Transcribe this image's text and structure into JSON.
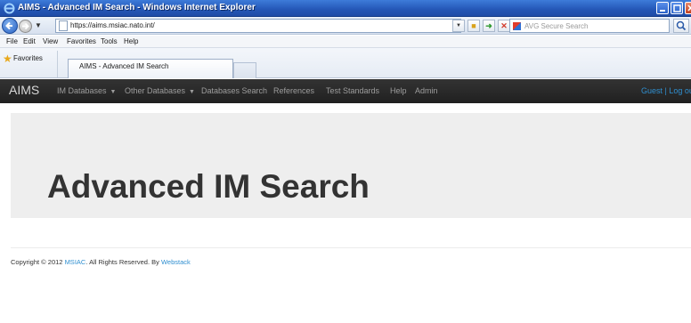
{
  "window": {
    "title": "AIMS - Advanced IM Search - Windows Internet Explorer"
  },
  "browser": {
    "address": "https://aims.msiac.nato.int/",
    "search_placeholder": "AVG Secure Search",
    "menu": [
      "File",
      "Edit",
      "View",
      "Favorites",
      "Tools",
      "Help"
    ],
    "favorites_label": "Favorites",
    "tab_title": "AIMS - Advanced IM Search"
  },
  "site": {
    "brand": "AIMS",
    "nav": [
      {
        "label": "IM Databases",
        "dropdown": true
      },
      {
        "label": "Other Databases",
        "dropdown": true
      },
      {
        "label": "Databases Search",
        "dropdown": false
      },
      {
        "label": "References",
        "dropdown": false
      },
      {
        "label": "Test Standards",
        "dropdown": false
      },
      {
        "label": "Help",
        "dropdown": false
      },
      {
        "label": "Admin",
        "dropdown": false
      }
    ],
    "user_links": "Guest | Log out"
  },
  "main": {
    "heading": "Advanced IM Search"
  },
  "footer": {
    "prefix": "Copyright © 2012 ",
    "org_link": "MSIAC",
    "middle": ". All Rights Reserved. By ",
    "vendor_link": "Webstack"
  },
  "colors": {
    "navbar_bg": "#222222",
    "link": "#2f8fd0",
    "jumbotron_bg": "#eeeeee"
  }
}
